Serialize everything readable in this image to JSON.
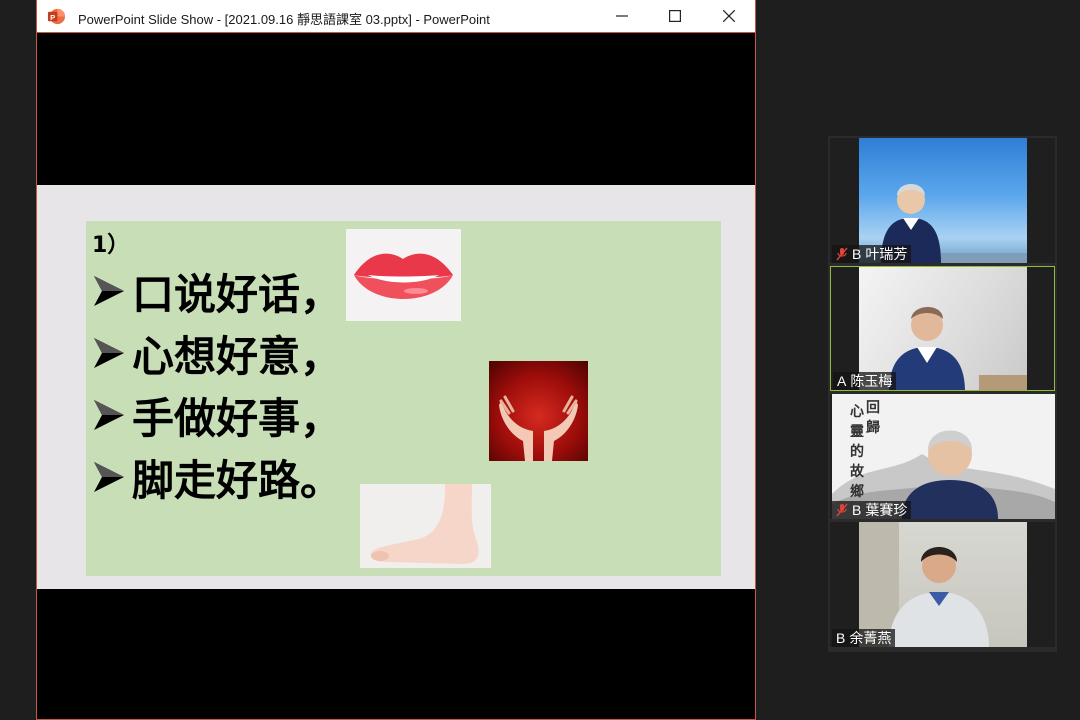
{
  "window": {
    "title": "PowerPoint Slide Show - [2021.09.16 靜思語課室 03.pptx] - PowerPoint",
    "border_color": "#c8553d",
    "icons": [
      "powerpoint-icon",
      "minimize-icon",
      "maximize-icon",
      "close-icon"
    ]
  },
  "slide": {
    "number": "1）",
    "bullets": [
      {
        "marker": "➢",
        "text": "口说好话，"
      },
      {
        "marker": "➢",
        "text": "心想好意，"
      },
      {
        "marker": "➢",
        "text": "手做好事，"
      },
      {
        "marker": "➢",
        "text": "脚走好路。"
      }
    ],
    "images": [
      "lips-image",
      "hands-image",
      "foot-image"
    ],
    "panel_color": "#c8deb6",
    "background_color": "#e8e5e8"
  },
  "participants": [
    {
      "tag": "B",
      "name": "叶瑞芳",
      "muted": true,
      "active": false
    },
    {
      "tag": "A",
      "name": "陈玉梅",
      "muted": false,
      "active": true
    },
    {
      "tag": "B",
      "name": "葉賽珍",
      "muted": true,
      "active": false,
      "background_text": "回歸心靈的故鄉"
    },
    {
      "tag": "B",
      "name": "余菁燕",
      "muted": false,
      "active": false
    }
  ],
  "colors": {
    "active_speaker_border": "#8fbf39",
    "mute_icon": "#e0433a"
  }
}
